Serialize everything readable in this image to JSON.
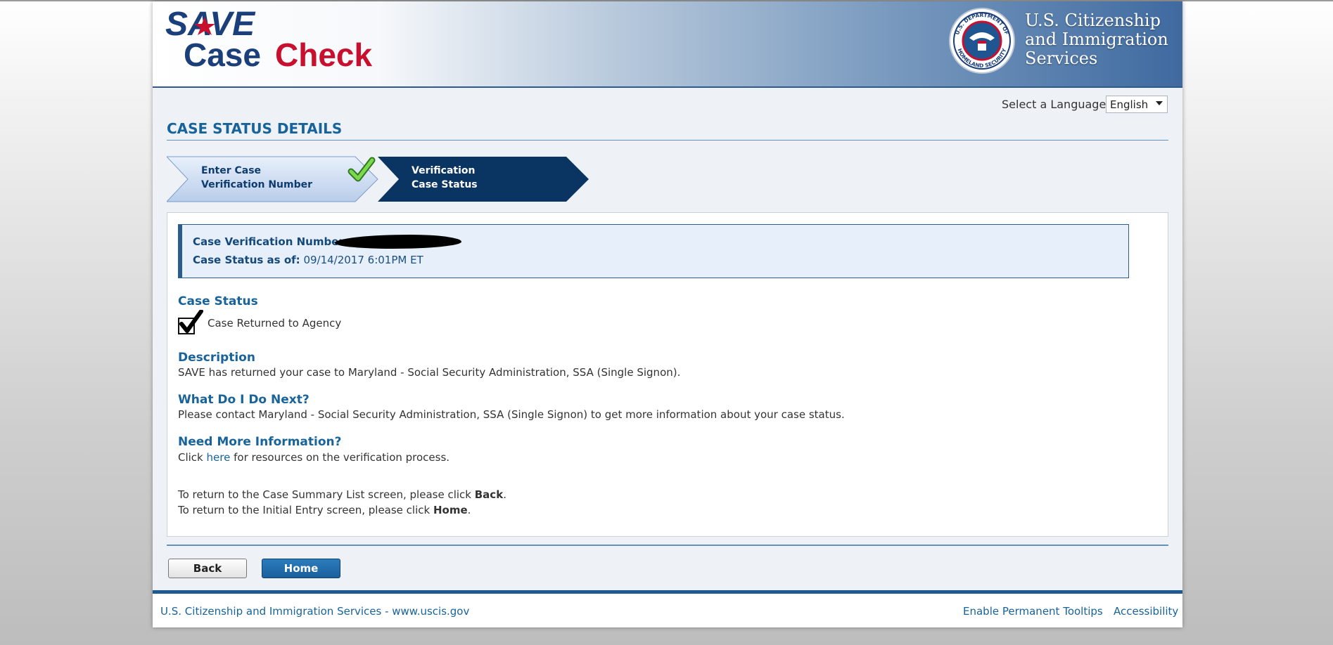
{
  "header": {
    "logo_line1": "SAVE",
    "logo_case": "Case",
    "logo_check": "Check",
    "agency_lines": [
      "U.S. Citizenship",
      "and Immigration",
      "Services"
    ],
    "seal_top": "U.S. DEPARTMENT OF",
    "seal_bottom": "HOMELAND SECURITY"
  },
  "language": {
    "label": "Select a Language:",
    "selected": "English"
  },
  "page_title": "CASE STATUS DETAILS",
  "steps": {
    "step1_line1": "Enter Case",
    "step1_line2": "Verification Number",
    "step2_line1": "Verification",
    "step2_line2": "Case Status"
  },
  "case_info": {
    "number_label": "Case Verification Number:",
    "status_label": "Case Status as of:",
    "status_value": "09/14/2017 6:01PM ET"
  },
  "case_status": {
    "heading": "Case Status",
    "value": "Case Returned to Agency"
  },
  "description": {
    "heading": "Description",
    "text": "SAVE has returned your case to Maryland - Social Security Administration, SSA (Single Signon)."
  },
  "next": {
    "heading": "What Do I Do Next?",
    "text": "Please contact  Maryland - Social Security Administration, SSA (Single Signon) to get more information about your case status."
  },
  "more_info": {
    "heading": "Need More Information?",
    "pre": "Click",
    "link": "here",
    "post": "for resources on the verification process."
  },
  "return_back": {
    "pre": "To return to the Case Summary List screen, please click",
    "bold": "Back",
    "post": "."
  },
  "return_home": {
    "pre": "To return to the Initial Entry screen, please click",
    "bold": "Home",
    "post": "."
  },
  "buttons": {
    "back": "Back",
    "home": "Home"
  },
  "footer": {
    "left": "U.S. Citizenship and Immigration Services - www.uscis.gov",
    "tooltips": "Enable Permanent Tooltips",
    "accessibility": "Accessibility"
  },
  "colors": {
    "brand_blue": "#17639a",
    "logo_red": "#c8102e",
    "logo_navy": "#1b3f7a",
    "step_active": "#0a3462"
  }
}
